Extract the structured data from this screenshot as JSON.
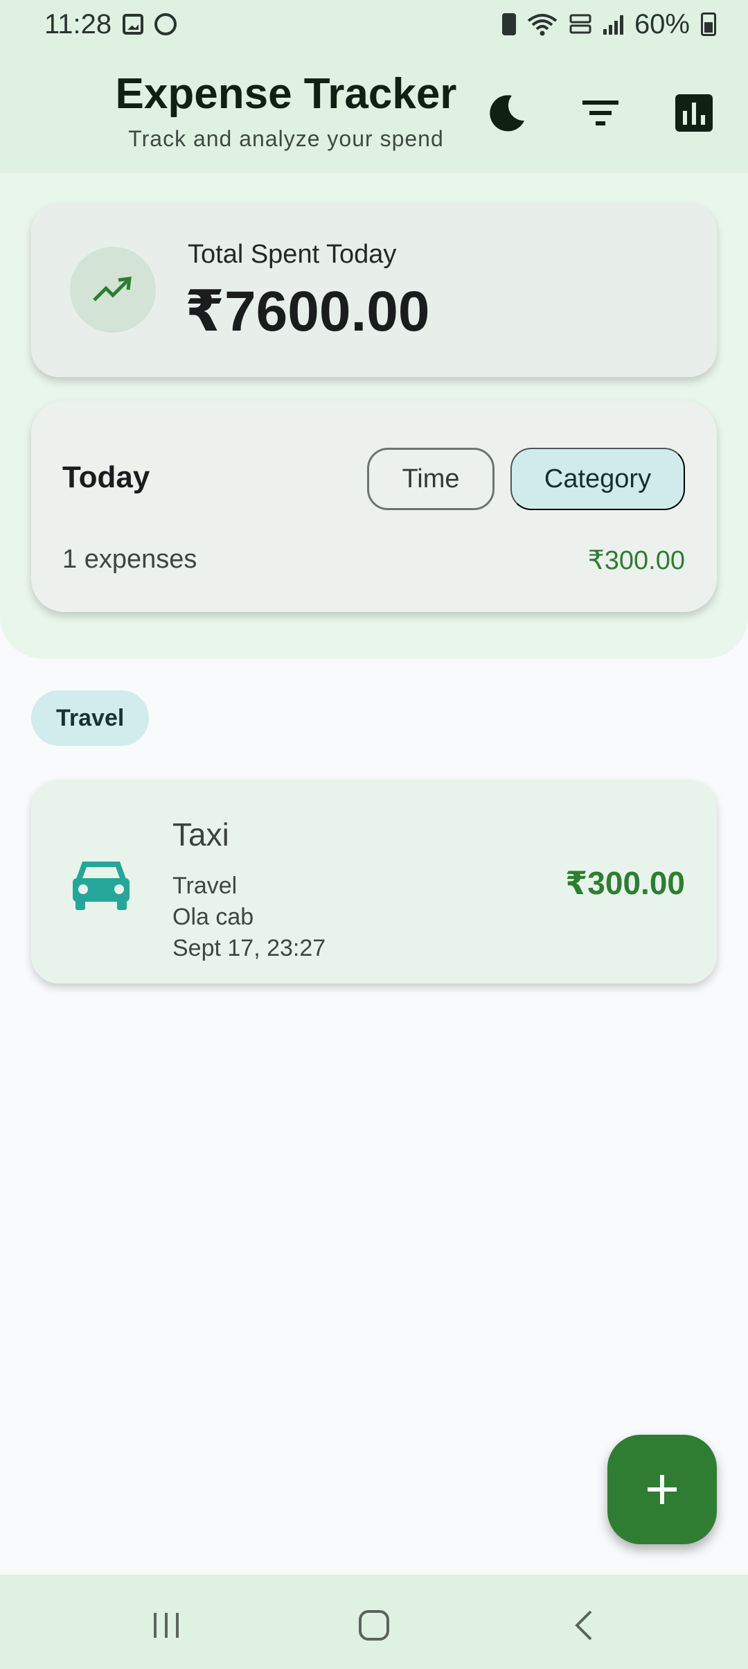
{
  "status_bar": {
    "time": "11:28",
    "battery": "60%",
    "icons": [
      "gallery-icon",
      "face-icon",
      "battery-saver-icon",
      "wifi-icon",
      "volte-icon",
      "signal-icon",
      "battery-icon"
    ]
  },
  "header": {
    "title": "Expense Tracker",
    "subtitle": "Track and analyze your spend",
    "actions": [
      "dark-mode-icon",
      "filter-icon",
      "analytics-icon"
    ]
  },
  "summary": {
    "label": "Total Spent Today",
    "value": "₹7600.00",
    "icon": "trending-up-icon"
  },
  "today": {
    "title": "Today",
    "toggle": {
      "time_label": "Time",
      "category_label": "Category",
      "selected": "Category"
    },
    "count_text": "1 expenses",
    "amount": "₹300.00"
  },
  "groups": [
    {
      "chip": "Travel",
      "items": [
        {
          "title": "Taxi",
          "category": "Travel",
          "note": "Ola cab",
          "date": "Sept 17, 23:27",
          "amount": "₹300.00",
          "icon": "car-icon"
        }
      ]
    }
  ],
  "colors": {
    "primary": "#2e7d32",
    "header_bg": "#dff1e1",
    "chip_bg": "#d0ecec",
    "car_icon": "#26a69a"
  }
}
